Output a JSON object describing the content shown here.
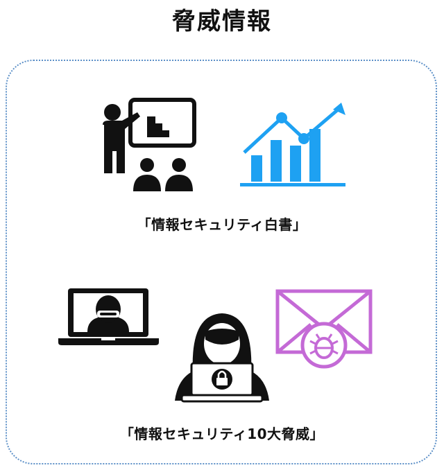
{
  "page": {
    "title": "脅威情報"
  },
  "sections": [
    {
      "caption": "「情報セキュリティ白書」",
      "icons": [
        "presentation-icon",
        "growth-chart-icon"
      ],
      "colors": {
        "chart": "#1ea1f2"
      }
    },
    {
      "caption": "「情報セキュリティ10大脅威」",
      "icons": [
        "laptop-hacker-icon",
        "hacker-icon",
        "malware-email-icon"
      ],
      "colors": {
        "email": "#c46ad6"
      }
    }
  ]
}
